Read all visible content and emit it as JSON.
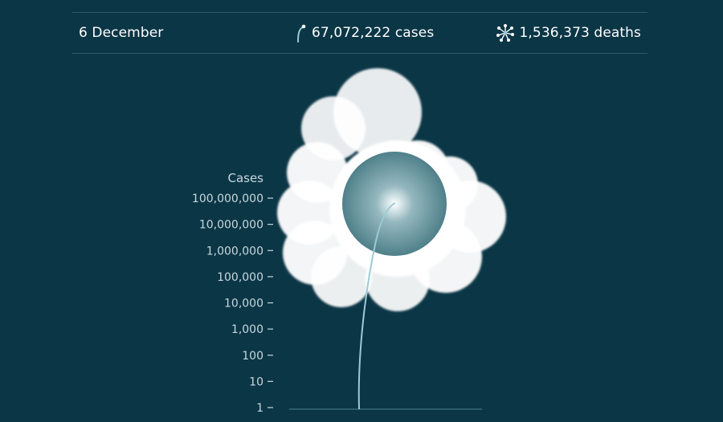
{
  "header": {
    "date": "6 December",
    "cases": "67,072,222 cases",
    "deaths": "1,536,373 deaths"
  },
  "icons": {
    "cases": "stem-icon",
    "deaths": "dandelion-seedhead-icon"
  },
  "colors": {
    "background": "#0b3646",
    "stem": "#9ccad6",
    "bloom": "#ffffff",
    "core": "#5d8d96",
    "axis_text": "#c9d8de"
  },
  "chart_data": {
    "type": "line",
    "scale": "log",
    "ylabel": "Cases",
    "ylim": [
      1,
      100000000
    ],
    "yticks": [
      {
        "value": 1,
        "label": "1"
      },
      {
        "value": 10,
        "label": "10"
      },
      {
        "value": 100,
        "label": "100"
      },
      {
        "value": 1000,
        "label": "1,000"
      },
      {
        "value": 10000,
        "label": "10,000"
      },
      {
        "value": 100000,
        "label": "100,000"
      },
      {
        "value": 1000000,
        "label": "1,000,000"
      },
      {
        "value": 10000000,
        "label": "10,000,000"
      },
      {
        "value": 100000000,
        "label": "100,000,000"
      }
    ],
    "current_cases": 67072222,
    "current_deaths": 1536373
  }
}
